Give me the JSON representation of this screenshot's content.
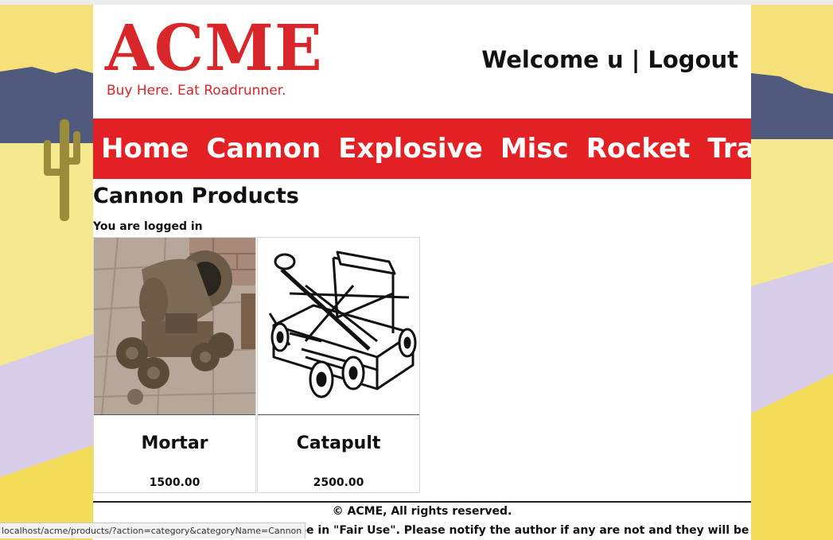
{
  "header": {
    "logo_title": "ACME",
    "logo_tagline": "Buy Here. Eat Roadrunner.",
    "welcome_text": "Welcome u",
    "separator": "|",
    "logout_label": "Logout"
  },
  "nav": {
    "items": [
      {
        "label": "Home"
      },
      {
        "label": "Cannon"
      },
      {
        "label": "Explosive"
      },
      {
        "label": "Misc"
      },
      {
        "label": "Rocket"
      },
      {
        "label": "Trap"
      }
    ]
  },
  "main": {
    "title": "Cannon Products",
    "login_status": "You are logged in",
    "products": [
      {
        "name": "Mortar",
        "price": "1500.00",
        "image_icon": "mortar-image"
      },
      {
        "name": "Catapult",
        "price": "2500.00",
        "image_icon": "catapult-image"
      }
    ]
  },
  "footer": {
    "copyright": "© ACME, All rights reserved.",
    "fair_use_fragment": "be in \"Fair Use\". Please notify the author if any are not and they will be"
  },
  "status_bar": {
    "url": "localhost/acme/products/?action=category&categoryName=Cannon"
  },
  "colors": {
    "brand_red": "#e32023",
    "logo_red": "#d9262a",
    "desert_yellow": "#f6e07a",
    "mountain_blue": "#4f5a7d",
    "cactus_olive": "#9a8c3b",
    "lavender": "#d7cde9"
  }
}
